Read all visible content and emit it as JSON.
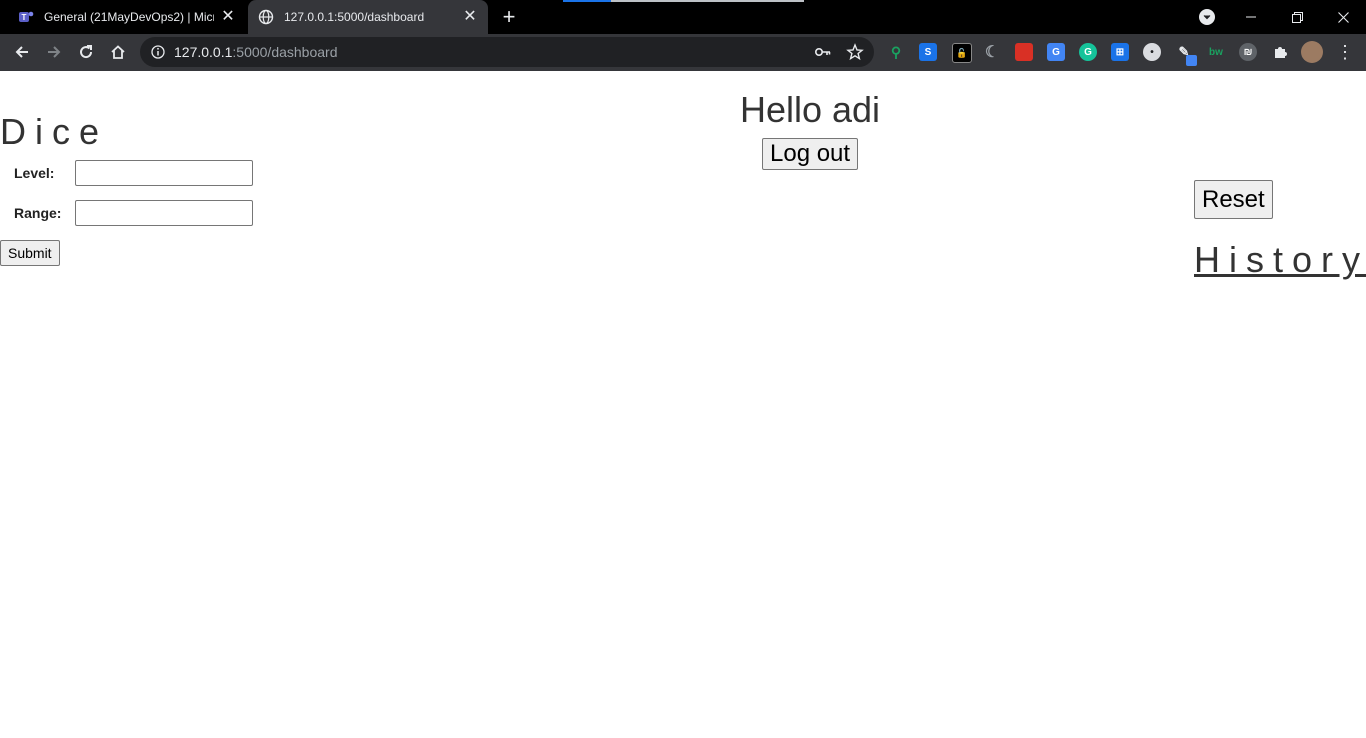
{
  "browser": {
    "tabs": [
      {
        "title": "General (21MayDevOps2) | Micro",
        "icon": "teams-icon"
      },
      {
        "title": "127.0.0.1:5000/dashboard",
        "icon": "globe-icon"
      }
    ],
    "url_host": "127.0.0.1",
    "url_rest": ":5000/dashboard",
    "extensions": [
      {
        "name": "keeper-icon",
        "color": "#1aa260",
        "glyph": "⚲"
      },
      {
        "name": "s-extension-icon",
        "color": "#1a73e8",
        "glyph": "S"
      },
      {
        "name": "lock-extension-icon",
        "color": "#111111",
        "glyph": "🔓"
      },
      {
        "name": "dark-mode-icon",
        "color": "#5f6368",
        "glyph": "☾"
      },
      {
        "name": "book-extension-icon",
        "color": "#d93025",
        "glyph": "▮"
      },
      {
        "name": "google-translate-icon",
        "color": "#4285f4",
        "glyph": "G"
      },
      {
        "name": "grammarly-icon",
        "color": "#15c39a",
        "glyph": "G"
      },
      {
        "name": "translate-box-icon",
        "color": "#1a73e8",
        "glyph": "⊞"
      },
      {
        "name": "circle-extension-icon",
        "color": "#dadce0",
        "glyph": "●"
      },
      {
        "name": "pen-extension-icon",
        "color": "#35363a",
        "glyph": "✎"
      },
      {
        "name": "bw-extension-icon",
        "color": "#35363a",
        "glyph": "bw"
      },
      {
        "name": "grey-circle-extension-icon",
        "color": "#5f6368",
        "glyph": "◐"
      }
    ]
  },
  "page": {
    "title": "Dice",
    "level_label": "Level:",
    "level_value": "",
    "range_label": "Range:",
    "range_value": "",
    "submit_label": "Submit",
    "greeting": "Hello adi",
    "logout_label": "Log out",
    "reset_label": "Reset",
    "history_label": "History"
  }
}
